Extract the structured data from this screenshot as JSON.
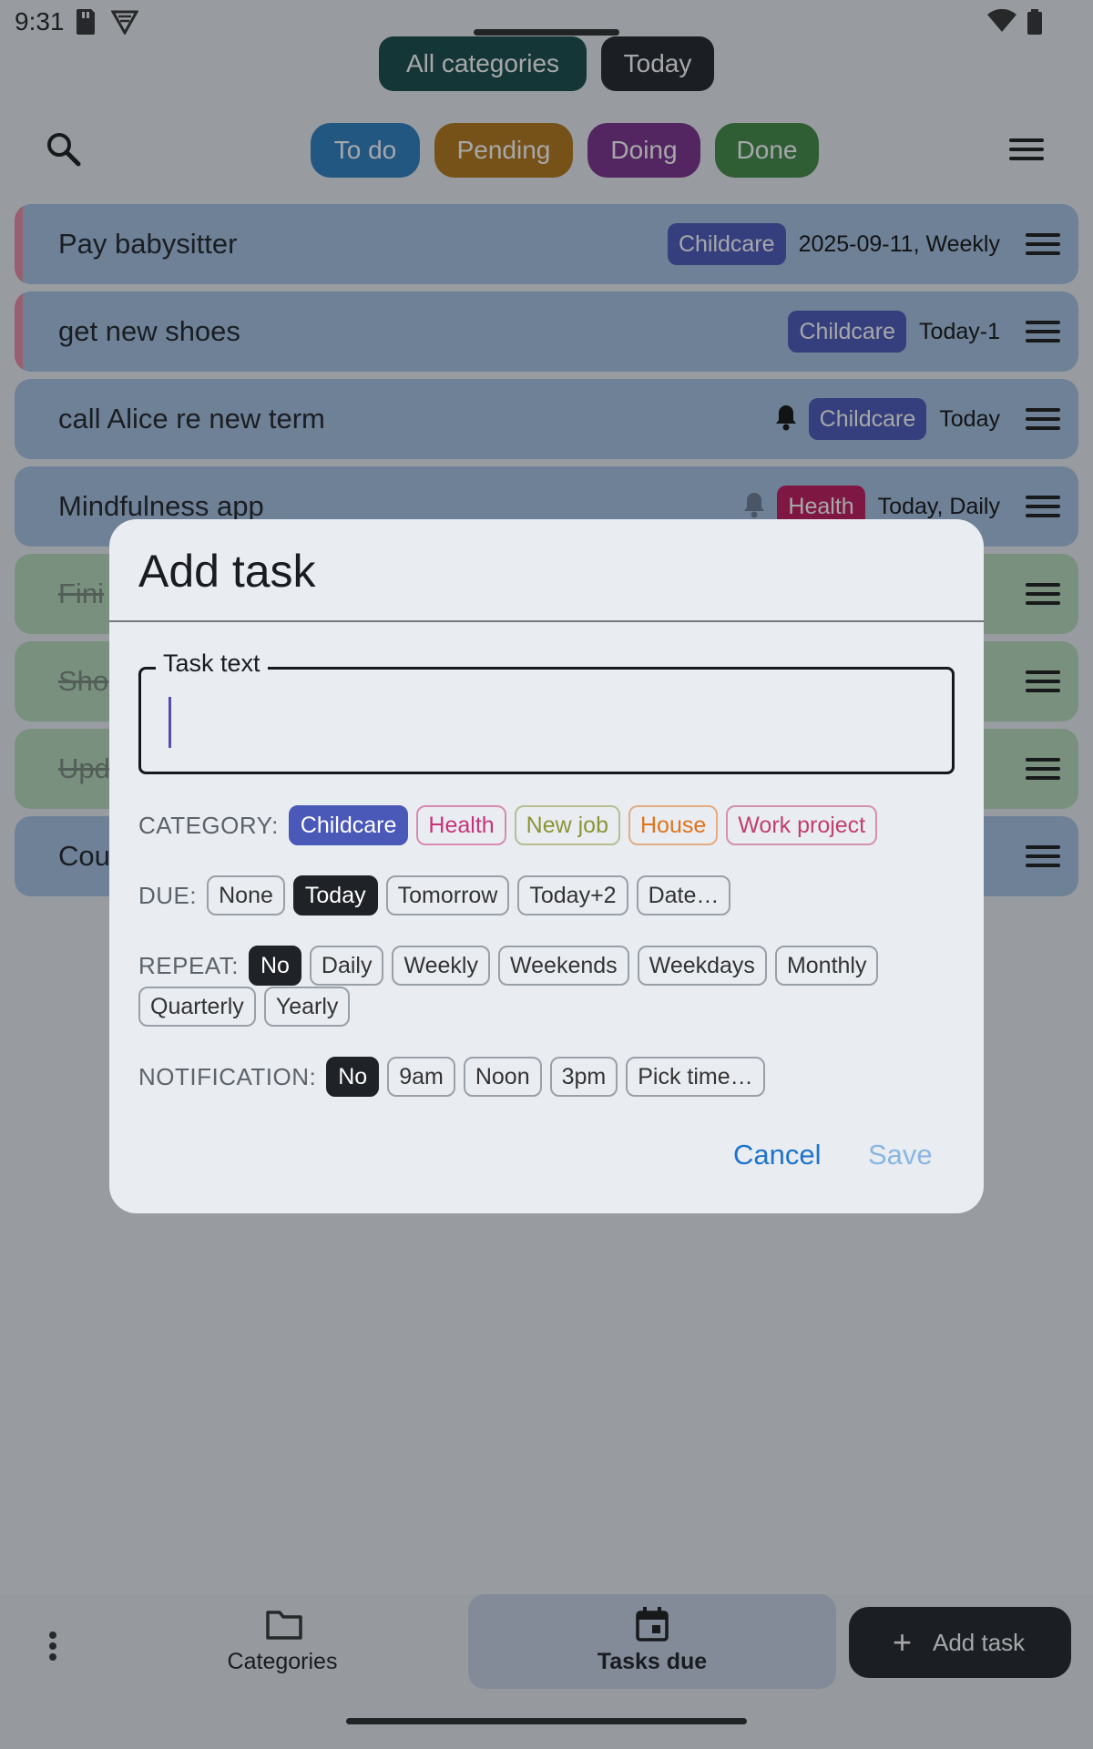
{
  "status_bar": {
    "time": "9:31"
  },
  "header": {
    "chips": [
      {
        "label": "All categories",
        "color": "#164a47"
      },
      {
        "label": "Today",
        "color": "#1f2227"
      }
    ],
    "status_filters": [
      {
        "label": "To do",
        "color": "#2b7ec1"
      },
      {
        "label": "Pending",
        "color": "#b37716"
      },
      {
        "label": "Doing",
        "color": "#7a2f8c"
      },
      {
        "label": "Done",
        "color": "#3f8a45"
      }
    ]
  },
  "tasks": [
    {
      "title": "Pay babysitter",
      "category": "Childcare",
      "due": "2025-09-11, Weekly",
      "bell": false,
      "overdue": true,
      "done": false
    },
    {
      "title": "get new shoes",
      "category": "Childcare",
      "due": "Today-1",
      "bell": false,
      "overdue": true,
      "done": false
    },
    {
      "title": "call Alice re new term",
      "category": "Childcare",
      "due": "Today",
      "bell": true,
      "bell_muted": false,
      "overdue": false,
      "done": false
    },
    {
      "title": "Mindfulness app",
      "category": "Health",
      "due": "Today, Daily",
      "bell": true,
      "bell_muted": true,
      "overdue": false,
      "done": false
    },
    {
      "title": "Fini",
      "done": true
    },
    {
      "title": "Sho",
      "done": true
    },
    {
      "title": "Upd",
      "done": true
    },
    {
      "title": "Cou",
      "done": false
    }
  ],
  "category_colors": {
    "Childcare": "#4a58b8",
    "Health": "#c1185b"
  },
  "dialog": {
    "title": "Add task",
    "task_field": {
      "label": "Task text",
      "value": ""
    },
    "category": {
      "label": "CATEGORY:",
      "options": [
        {
          "label": "Childcare",
          "selected": true,
          "color": "#4a58b8"
        },
        {
          "label": "Health",
          "selected": false,
          "color": "#c8327a"
        },
        {
          "label": "New job",
          "selected": false,
          "color": "#8c9438"
        },
        {
          "label": "House",
          "selected": false,
          "color": "#e0731e"
        },
        {
          "label": "Work project",
          "selected": false,
          "color": "#c0406e"
        }
      ]
    },
    "due": {
      "label": "DUE:",
      "options": [
        {
          "label": "None",
          "selected": false
        },
        {
          "label": "Today",
          "selected": true
        },
        {
          "label": "Tomorrow",
          "selected": false
        },
        {
          "label": "Today+2",
          "selected": false
        },
        {
          "label": "Date…",
          "selected": false
        }
      ]
    },
    "repeat": {
      "label": "REPEAT:",
      "options": [
        {
          "label": "No",
          "selected": true
        },
        {
          "label": "Daily",
          "selected": false
        },
        {
          "label": "Weekly",
          "selected": false
        },
        {
          "label": "Weekends",
          "selected": false
        },
        {
          "label": "Weekdays",
          "selected": false
        },
        {
          "label": "Monthly",
          "selected": false
        },
        {
          "label": "Quarterly",
          "selected": false
        },
        {
          "label": "Yearly",
          "selected": false
        }
      ]
    },
    "notification": {
      "label": "NOTIFICATION:",
      "options": [
        {
          "label": "No",
          "selected": true
        },
        {
          "label": "9am",
          "selected": false
        },
        {
          "label": "Noon",
          "selected": false
        },
        {
          "label": "3pm",
          "selected": false
        },
        {
          "label": "Pick time…",
          "selected": false
        }
      ]
    },
    "cancel_label": "Cancel",
    "save_label": "Save",
    "accent": "#1f74c9"
  },
  "bottom_nav": {
    "items": [
      {
        "label": "Categories",
        "icon": "folder-icon",
        "active": false
      },
      {
        "label": "Tasks due",
        "icon": "calendar-icon",
        "active": true
      }
    ],
    "fab_label": "Add task"
  }
}
